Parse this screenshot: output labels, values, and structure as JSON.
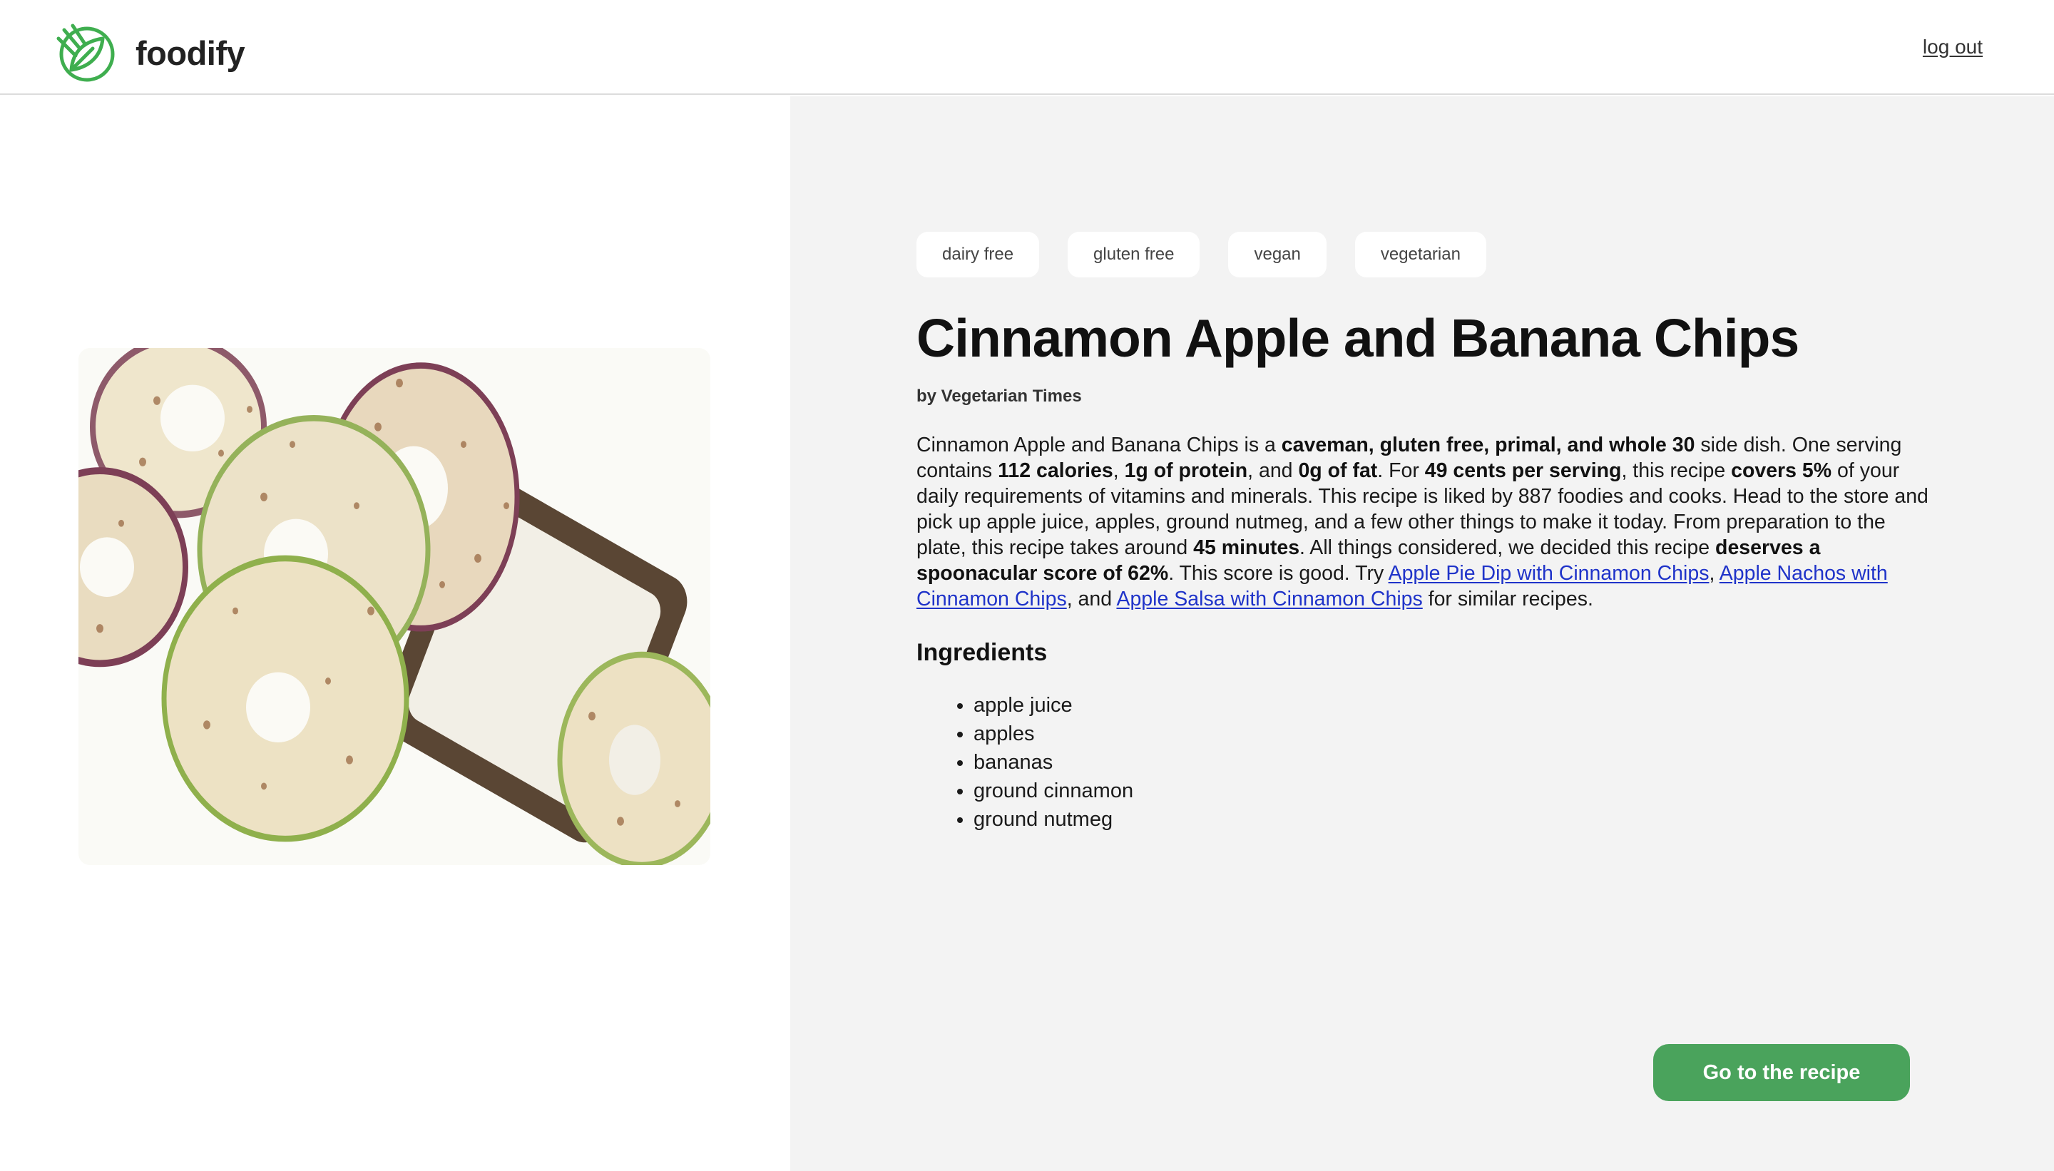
{
  "header": {
    "brand_name": "foodify",
    "logo_icon": "leaf-fork-icon",
    "logout_label": "log out",
    "brand_color": "#3fae4f"
  },
  "recipe": {
    "image_icon": "apple-banana-chips-photo",
    "tags": [
      "dairy free",
      "gluten free",
      "vegan",
      "vegetarian"
    ],
    "title": "Cinnamon Apple and Banana Chips",
    "author": "by Vegetarian Times",
    "summary": {
      "s1": "Cinnamon Apple and Banana Chips is a ",
      "b1": "caveman, gluten free, primal, and whole 30",
      "s2": " side dish. One serving contains ",
      "b2": "112 calories",
      "s3": ", ",
      "b3": "1g of protein",
      "s4": ", and ",
      "b4": "0g of fat",
      "s5": ". For ",
      "b5": "49 cents per serving",
      "s6": ", this recipe ",
      "b6": "covers 5%",
      "s7": " of your daily requirements of vitamins and minerals. This recipe is liked by 887 foodies and cooks. Head to the store and pick up apple juice, apples, ground nutmeg, and a few other things to make it today. From preparation to the plate, this recipe takes around ",
      "b7": "45 minutes",
      "s8": ". All things considered, we decided this recipe ",
      "b8": "deserves a spoonacular score of 62%",
      "s9": ". This score is good. Try ",
      "link1": "Apple Pie Dip with Cinnamon Chips",
      "s10": ", ",
      "link2": "Apple Nachos with Cinnamon Chips",
      "s11": ", and ",
      "link3": "Apple Salsa with Cinnamon Chips",
      "s12": " for similar recipes."
    },
    "ingredients_heading": "Ingredients",
    "ingredients": [
      "apple juice",
      "apples",
      "bananas",
      "ground cinnamon",
      "ground nutmeg"
    ],
    "cta_label": "Go to the recipe",
    "cta_color": "#4aa35c",
    "link_color": "#1f33c9"
  }
}
